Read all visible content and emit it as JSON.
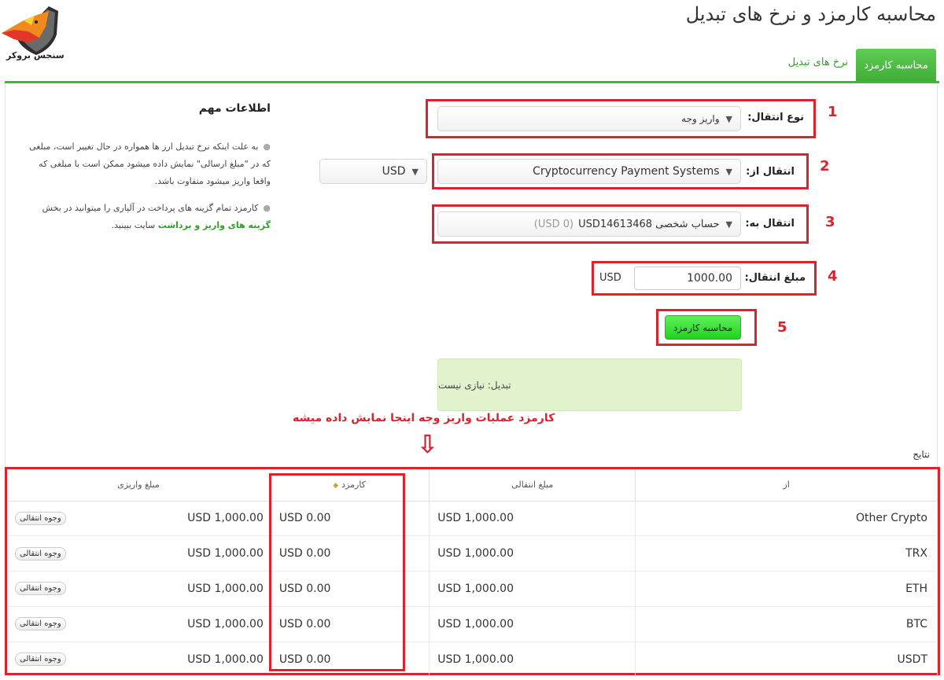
{
  "logo_text": "سنجس بروکر",
  "page_title": "محاسبه کارمزد و نرخ های تبدیل",
  "tabs": [
    {
      "label": "محاسبه کارمزد",
      "active": true
    },
    {
      "label": "نرخ های تبدیل",
      "active": false
    }
  ],
  "info": {
    "title": "اطلاعات مهم",
    "p1": "به علت اینکه نرخ تبدیل ارز ها همواره در حال تغییر است، مبلغی که در \"مبلغ ارسالی\" نمایش داده میشود ممکن است با مبلغی که واقعا واریز میشود متفاوت باشد.",
    "p2_a": "کارمزد تمام گزینه های پرداخت در آلپاری را میتوانید در بخش",
    "p2_link": "گزینه های واریز و برداشت",
    "p2_b": "سایت ببینید."
  },
  "form": {
    "type_label": "نوع انتقال:",
    "type_value": "واریز وجه",
    "from_label": "انتقال از:",
    "from_value": "Cryptocurrency Payment Systems",
    "currency_value": "USD",
    "to_label": "انتقال به:",
    "to_account": "حساب شخصی USD14613468",
    "to_balance": "(USD 0)",
    "amount_label": "مبلغ انتقال:",
    "amount_value": "1000.00",
    "amount_currency": "USD",
    "calc_button": "محاسبه کارمزد",
    "result_text": "تبدیل: نیازی نیست"
  },
  "annotations": {
    "n1": "1",
    "n2": "2",
    "n3": "3",
    "n4": "4",
    "n5": "5",
    "note": "کارمزد عملیات واریز وجه اینجا نمایش داده میشه",
    "arrow": "⇩"
  },
  "results_label": "نتایج",
  "table": {
    "headers": {
      "from": "از",
      "transfer_amount": "مبلغ انتقالی",
      "fee": "کارمزد",
      "deposit_amount": "مبلغ واریزی"
    },
    "row_button": "وجوه انتقالی",
    "rows": [
      {
        "from": "Other Crypto",
        "transfer": "USD 1,000.00",
        "fee": "USD 0.00",
        "deposit": "USD 1,000.00"
      },
      {
        "from": "TRX",
        "transfer": "USD 1,000.00",
        "fee": "USD 0.00",
        "deposit": "USD 1,000.00"
      },
      {
        "from": "ETH",
        "transfer": "USD 1,000.00",
        "fee": "USD 0.00",
        "deposit": "USD 1,000.00"
      },
      {
        "from": "BTC",
        "transfer": "USD 1,000.00",
        "fee": "USD 0.00",
        "deposit": "USD 1,000.00"
      },
      {
        "from": "USDT",
        "transfer": "USD 1,000.00",
        "fee": "USD 0.00",
        "deposit": "USD 1,000.00"
      }
    ]
  },
  "colors": {
    "accent_green": "#44b33b",
    "annotation_red": "#d9232d",
    "result_bg": "#e1f3cd"
  }
}
